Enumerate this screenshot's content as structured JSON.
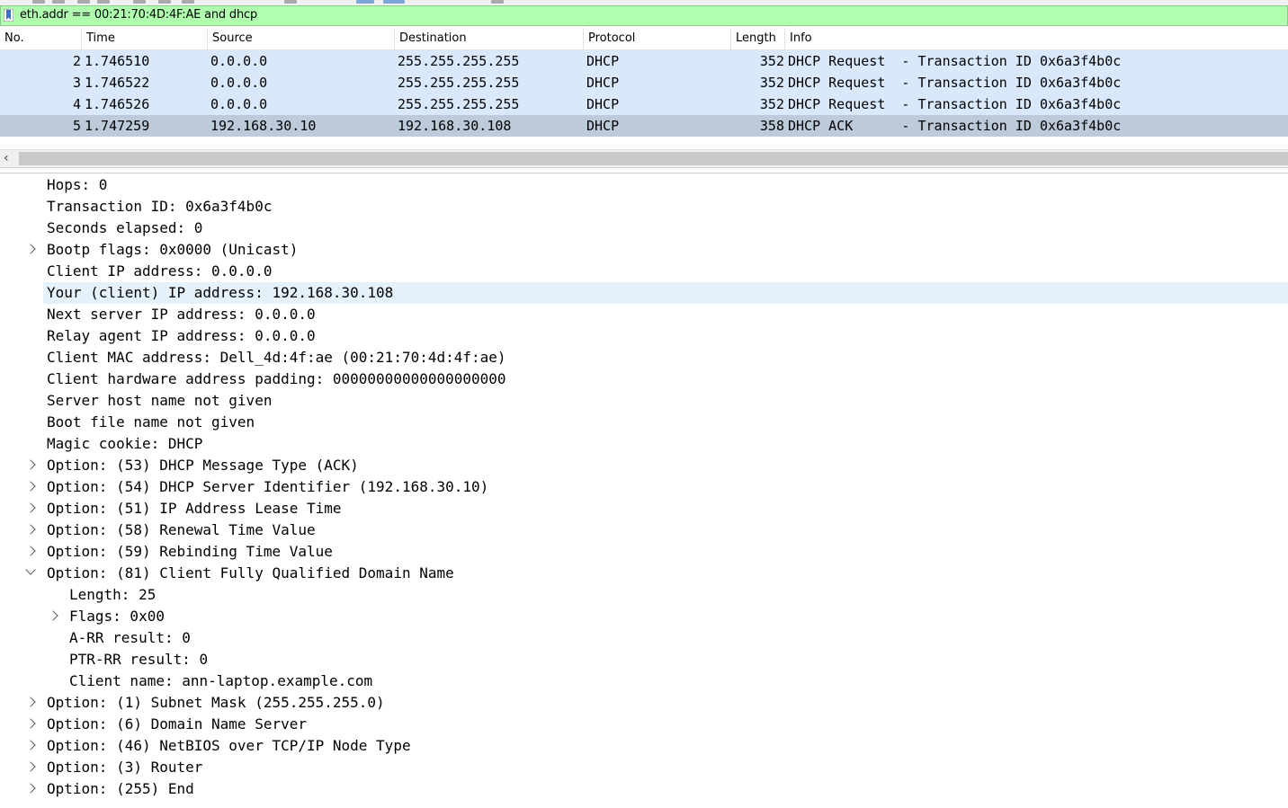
{
  "display_filter": {
    "text": "eth.addr == 00:21:70:4D:4F:AE and dhcp",
    "bg_color": "#afffaf"
  },
  "packet_list": {
    "columns": [
      "No.",
      "Time",
      "Source",
      "Destination",
      "Protocol",
      "Length",
      "Info"
    ],
    "rows": [
      {
        "no": "2",
        "time": "1.746510",
        "src": "0.0.0.0",
        "dst": "255.255.255.255",
        "proto": "DHCP",
        "len": "352",
        "info": "DHCP Request  - Transaction ID 0x6a3f4b0c"
      },
      {
        "no": "3",
        "time": "1.746522",
        "src": "0.0.0.0",
        "dst": "255.255.255.255",
        "proto": "DHCP",
        "len": "352",
        "info": "DHCP Request  - Transaction ID 0x6a3f4b0c"
      },
      {
        "no": "4",
        "time": "1.746526",
        "src": "0.0.0.0",
        "dst": "255.255.255.255",
        "proto": "DHCP",
        "len": "352",
        "info": "DHCP Request  - Transaction ID 0x6a3f4b0c"
      },
      {
        "no": "5",
        "time": "1.747259",
        "src": "192.168.30.10",
        "dst": "192.168.30.108",
        "proto": "DHCP",
        "len": "358",
        "info": "DHCP ACK      - Transaction ID 0x6a3f4b0c"
      }
    ],
    "selected_row": "5",
    "row_color": "#dae8fb",
    "selected_color": "#bccad9"
  },
  "packet_details": {
    "fields": [
      {
        "text": "Hops: 0",
        "level": 1,
        "expander": "none"
      },
      {
        "text": "Transaction ID: 0x6a3f4b0c",
        "level": 1,
        "expander": "none"
      },
      {
        "text": "Seconds elapsed: 0",
        "level": 1,
        "expander": "none"
      },
      {
        "text": "Bootp flags: 0x0000 (Unicast)",
        "level": 1,
        "expander": "collapsed"
      },
      {
        "text": "Client IP address: 0.0.0.0",
        "level": 1,
        "expander": "none"
      },
      {
        "text": "Your (client) IP address: 192.168.30.108",
        "level": 1,
        "expander": "none",
        "highlighted": true
      },
      {
        "text": "Next server IP address: 0.0.0.0",
        "level": 1,
        "expander": "none"
      },
      {
        "text": "Relay agent IP address: 0.0.0.0",
        "level": 1,
        "expander": "none"
      },
      {
        "text": "Client MAC address: Dell_4d:4f:ae (00:21:70:4d:4f:ae)",
        "level": 1,
        "expander": "none"
      },
      {
        "text": "Client hardware address padding: 00000000000000000000",
        "level": 1,
        "expander": "none"
      },
      {
        "text": "Server host name not given",
        "level": 1,
        "expander": "none"
      },
      {
        "text": "Boot file name not given",
        "level": 1,
        "expander": "none"
      },
      {
        "text": "Magic cookie: DHCP",
        "level": 1,
        "expander": "none"
      },
      {
        "text": "Option: (53) DHCP Message Type (ACK)",
        "level": 1,
        "expander": "collapsed"
      },
      {
        "text": "Option: (54) DHCP Server Identifier (192.168.30.10)",
        "level": 1,
        "expander": "collapsed"
      },
      {
        "text": "Option: (51) IP Address Lease Time",
        "level": 1,
        "expander": "collapsed"
      },
      {
        "text": "Option: (58) Renewal Time Value",
        "level": 1,
        "expander": "collapsed"
      },
      {
        "text": "Option: (59) Rebinding Time Value",
        "level": 1,
        "expander": "collapsed"
      },
      {
        "text": "Option: (81) Client Fully Qualified Domain Name",
        "level": 1,
        "expander": "expanded"
      },
      {
        "text": "Length: 25",
        "level": 2,
        "expander": "none"
      },
      {
        "text": "Flags: 0x00",
        "level": 2,
        "expander": "collapsed"
      },
      {
        "text": "A-RR result: 0",
        "level": 2,
        "expander": "none"
      },
      {
        "text": "PTR-RR result: 0",
        "level": 2,
        "expander": "none"
      },
      {
        "text": "Client name: ann-laptop.example.com",
        "level": 2,
        "expander": "none"
      },
      {
        "text": "Option: (1) Subnet Mask (255.255.255.0)",
        "level": 1,
        "expander": "collapsed"
      },
      {
        "text": "Option: (6) Domain Name Server",
        "level": 1,
        "expander": "collapsed"
      },
      {
        "text": "Option: (46) NetBIOS over TCP/IP Node Type",
        "level": 1,
        "expander": "collapsed"
      },
      {
        "text": "Option: (3) Router",
        "level": 1,
        "expander": "collapsed"
      },
      {
        "text": "Option: (255) End",
        "level": 1,
        "expander": "collapsed"
      }
    ],
    "highlight_color": "#e5f1fb"
  }
}
